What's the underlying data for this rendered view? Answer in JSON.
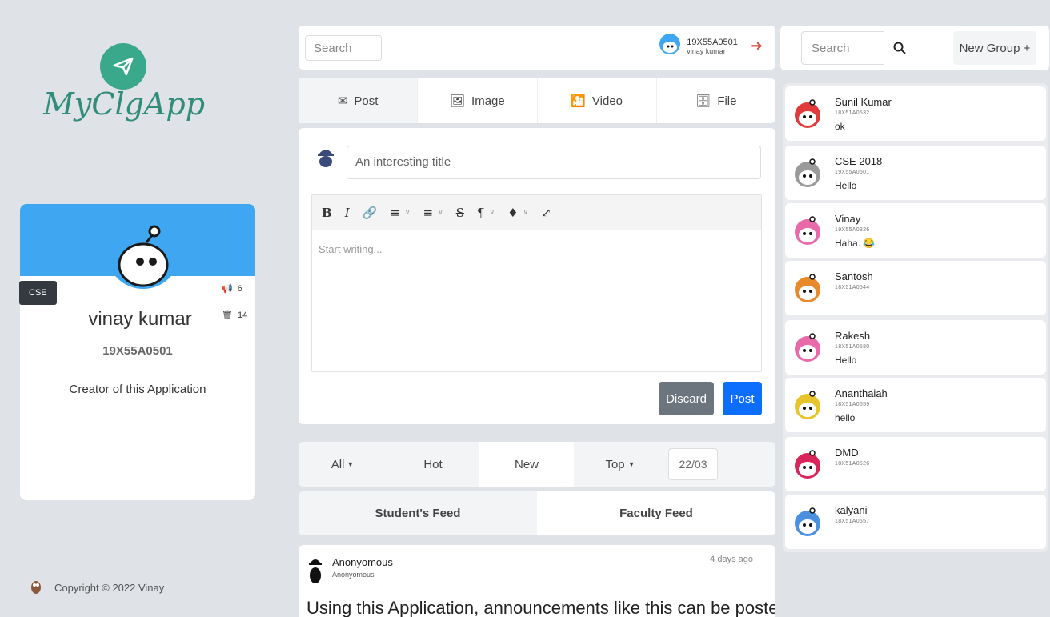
{
  "app": {
    "logo_text": "MyClgApp"
  },
  "profile": {
    "dept_badge": "CSE",
    "name": "vinay kumar",
    "id": "19X55A0501",
    "bio": "Creator of this Application",
    "stats": [
      {
        "icon": "megaphone-icon",
        "value": "6"
      },
      {
        "icon": "trash-icon",
        "value": "14"
      }
    ]
  },
  "footer": {
    "copyright": "Copyright © 2022 Vinay"
  },
  "topbar": {
    "search_placeholder": "Search",
    "user_id": "19X55A0501",
    "user_name": "vinay kumar"
  },
  "tabs": [
    {
      "label": "Post",
      "icon": "envelope-icon"
    },
    {
      "label": "Image",
      "icon": "file-image-icon"
    },
    {
      "label": "Video",
      "icon": "file-video-icon"
    },
    {
      "label": "File",
      "icon": "file-icon"
    }
  ],
  "composer": {
    "title_placeholder": "An interesting title",
    "body_placeholder": "Start writing...",
    "discard_label": "Discard",
    "post_label": "Post"
  },
  "filters": {
    "all": "All",
    "hot": "Hot",
    "new": "New",
    "top": "Top",
    "date": "22/03"
  },
  "feed_tabs": {
    "student": "Student's Feed",
    "faculty": "Faculty Feed"
  },
  "post": {
    "author": "Anonyomous",
    "author_sub": "Anonyomous",
    "time": "4 days ago",
    "body": "Using this Application, announcements like this can be posted"
  },
  "right": {
    "search_placeholder": "Search",
    "new_group_label": "New Group +"
  },
  "chats": [
    {
      "name": "Sunil Kumar",
      "id": "18X51A0532",
      "msg": "ok",
      "color": "#e03a3a"
    },
    {
      "name": "CSE 2018",
      "id": "19X55A0501",
      "msg": "Hello",
      "color": "#9a9a9a"
    },
    {
      "name": "Vinay",
      "id": "19X55A0326",
      "msg": "Haha. 😂",
      "color": "#e86aa8"
    },
    {
      "name": "Santosh",
      "id": "18X51A0544",
      "msg": "",
      "color": "#e8892c"
    },
    {
      "name": "Rakesh",
      "id": "18X51A0580",
      "msg": "Hello",
      "color": "#e86aa8"
    },
    {
      "name": "Ananthaiah",
      "id": "18X51A0559",
      "msg": "hello",
      "color": "#e8c52c"
    },
    {
      "name": "DMD",
      "id": "18X51A0526",
      "msg": "",
      "color": "#d8255a"
    },
    {
      "name": "kalyani",
      "id": "18X51A0557",
      "msg": "",
      "color": "#4a8fe0"
    }
  ]
}
